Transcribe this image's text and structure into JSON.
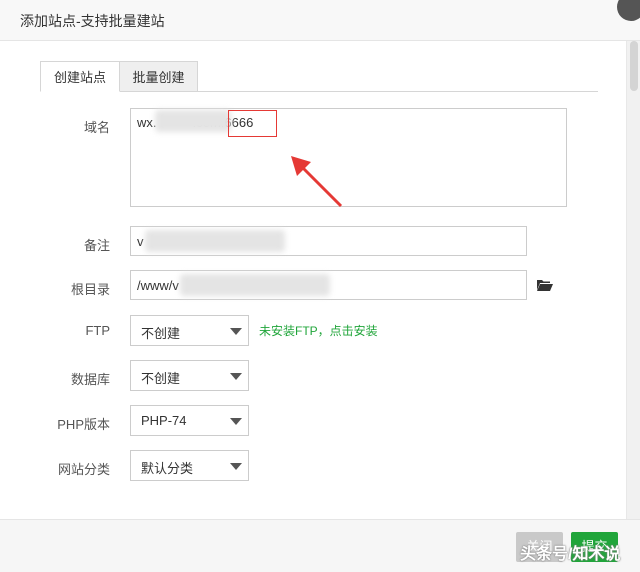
{
  "dialog": {
    "title": "添加站点-支持批量建站"
  },
  "tabs": [
    {
      "label": "创建站点",
      "active": true
    },
    {
      "label": "批量创建",
      "active": false
    }
  ],
  "form": {
    "domain": {
      "label": "域名",
      "value": "wx.          .com:6666",
      "highlight": "6666"
    },
    "remark": {
      "label": "备注",
      "value": "v"
    },
    "root": {
      "label": "根目录",
      "value": "/www/v"
    },
    "ftp": {
      "label": "FTP",
      "selected": "不创建",
      "hint": "未安装FTP，点击安装"
    },
    "database": {
      "label": "数据库",
      "selected": "不创建"
    },
    "php": {
      "label": "PHP版本",
      "selected": "PHP-74"
    },
    "category": {
      "label": "网站分类",
      "selected": "默认分类"
    }
  },
  "footer": {
    "cancel_label": "关闭",
    "submit_label": "提交"
  },
  "watermark": "头条号/知术说",
  "colors": {
    "accent": "#20a53a",
    "highlight": "#e53935"
  },
  "icons": {
    "folder": "folder-open-icon",
    "annotation": "red-arrow-icon"
  }
}
